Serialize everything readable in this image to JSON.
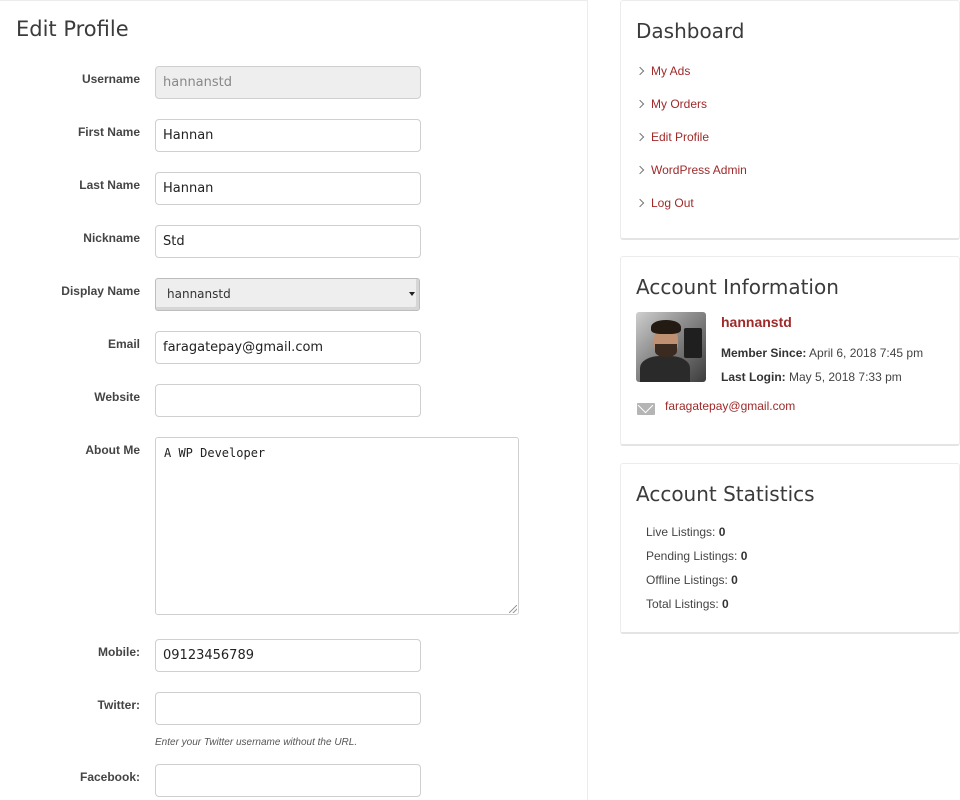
{
  "page_title": "Edit Profile",
  "form": {
    "username": {
      "label": "Username",
      "value": "hannanstd"
    },
    "first_name": {
      "label": "First Name",
      "value": "Hannan"
    },
    "last_name": {
      "label": "Last Name",
      "value": "Hannan"
    },
    "nickname": {
      "label": "Nickname",
      "value": "Std"
    },
    "display_name": {
      "label": "Display Name",
      "selected": "hannanstd"
    },
    "email": {
      "label": "Email",
      "value": "faragatepay@gmail.com"
    },
    "website": {
      "label": "Website",
      "value": ""
    },
    "about_me": {
      "label": "About Me",
      "value": "A WP Developer"
    },
    "mobile": {
      "label": "Mobile:",
      "value": "09123456789"
    },
    "twitter": {
      "label": "Twitter:",
      "value": "",
      "hint": "Enter your Twitter username without the URL."
    },
    "facebook": {
      "label": "Facebook:",
      "value": ""
    }
  },
  "sidebar": {
    "dashboard": {
      "title": "Dashboard",
      "items": [
        {
          "label": "My Ads",
          "icon": "chevron-right-icon"
        },
        {
          "label": "My Orders",
          "icon": "chevron-right-icon"
        },
        {
          "label": "Edit Profile",
          "icon": "chevron-right-icon"
        },
        {
          "label": "WordPress Admin",
          "icon": "chevron-right-icon"
        },
        {
          "label": "Log Out",
          "icon": "chevron-right-icon"
        }
      ]
    },
    "account_info": {
      "title": "Account Information",
      "username": "hannanstd",
      "member_since_label": "Member Since:",
      "member_since_value": "April 6, 2018 7:45 pm",
      "last_login_label": "Last Login:",
      "last_login_value": "May 5, 2018 7:33 pm",
      "email": "faragatepay@gmail.com",
      "email_icon": "envelope-icon"
    },
    "account_stats": {
      "title": "Account Statistics",
      "items": [
        {
          "label": "Live Listings:",
          "value": "0"
        },
        {
          "label": "Pending Listings:",
          "value": "0"
        },
        {
          "label": "Offline Listings:",
          "value": "0"
        },
        {
          "label": "Total Listings:",
          "value": "0"
        }
      ]
    }
  },
  "colors": {
    "link": "#a02a2a",
    "heading": "#3b3b3b",
    "border": "#cfcfcf"
  }
}
